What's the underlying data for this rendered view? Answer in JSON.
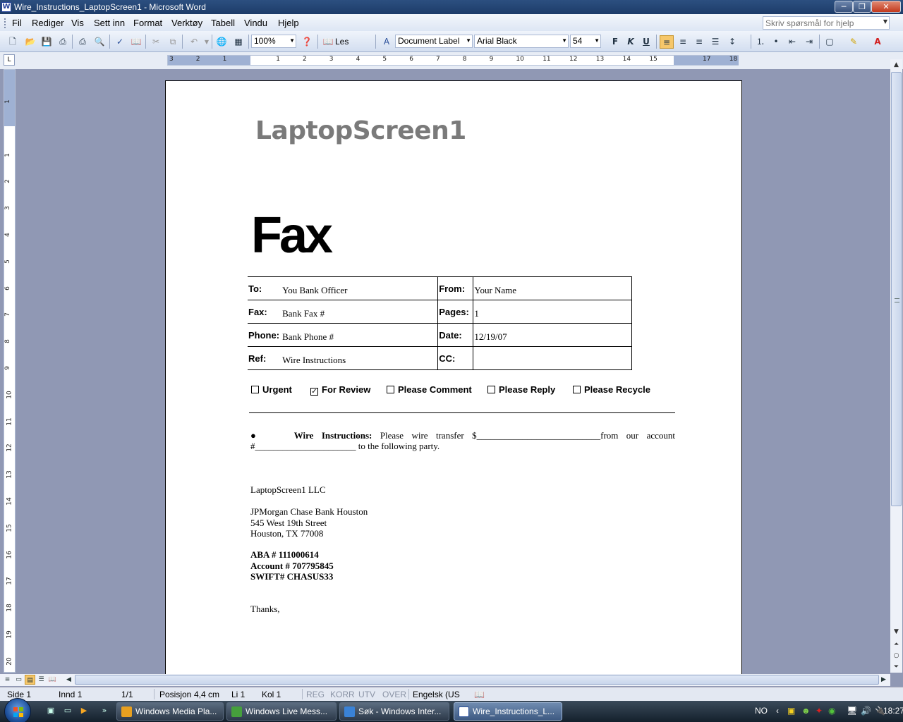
{
  "window": {
    "title": "Wire_Instructions_LaptopScreen1 - Microsoft Word",
    "app_icon": "W",
    "min_glyph": "─",
    "max_glyph": "❐",
    "close_glyph": "✕"
  },
  "menu": {
    "items": [
      "Fil",
      "Rediger",
      "Vis",
      "Sett inn",
      "Format",
      "Verktøy",
      "Tabell",
      "Vindu",
      "Hjelp"
    ],
    "help_placeholder": "Skriv spørsmål for hjelp"
  },
  "toolbar": {
    "zoom": "100%",
    "read_label": "Les",
    "style": "Document Label",
    "font": "Arial Black",
    "size": "54",
    "bold": "F",
    "italic": "K",
    "underline": "U"
  },
  "ruler": {
    "corner": "L",
    "h_numbers": [
      "3",
      "2",
      "1",
      "",
      "1",
      "2",
      "3",
      "4",
      "5",
      "6",
      "7",
      "8",
      "9",
      "10",
      "11",
      "12",
      "13",
      "14",
      "15",
      "",
      "17",
      "18"
    ],
    "v_numbers": [
      "1",
      "",
      "1",
      "2",
      "3",
      "4",
      "5",
      "6",
      "7",
      "8",
      "9",
      "10",
      "11",
      "12",
      "13",
      "14",
      "15",
      "16",
      "17",
      "18",
      "19",
      "20"
    ]
  },
  "document": {
    "logo": "LaptopScreen1",
    "title": "Fax",
    "fields": [
      {
        "label": "To:",
        "value": "You Bank Officer",
        "label2": "From:",
        "value2": "Your Name"
      },
      {
        "label": "Fax:",
        "value": "Bank Fax #",
        "label2": "Pages:",
        "value2": "1"
      },
      {
        "label": "Phone:",
        "value": "Bank Phone #",
        "label2": "Date:",
        "value2": "12/19/07"
      },
      {
        "label": "Ref:",
        "value": "Wire Instructions",
        "label2": "CC:",
        "value2": ""
      }
    ],
    "checkboxes": [
      {
        "label": "Urgent",
        "checked": false
      },
      {
        "label": "For Review",
        "checked": true
      },
      {
        "label": "Please Comment",
        "checked": false
      },
      {
        "label": "Please Reply",
        "checked": false
      },
      {
        "label": "Please Recycle",
        "checked": false
      }
    ],
    "bullet": "●",
    "wire_heading": "Wire Instructions:",
    "wire_line1_a": "Please wire transfer $",
    "wire_blank1": "___________________________",
    "wire_line1_b": "from our account",
    "wire_line2_a": "#",
    "wire_blank2": "______________________",
    "wire_line2_b": " to the following party.",
    "company": "LaptopScreen1 LLC",
    "bank_name": "JPMorgan Chase Bank Houston",
    "bank_street": "545 West 19th Street",
    "bank_city": "Houston, TX 77008",
    "aba": "ABA # 111000614",
    "account": "Account # 707795845",
    "swift": "SWIFT# CHASUS33",
    "closing": "Thanks,"
  },
  "status": {
    "page": "Side 1",
    "section": "Innd 1",
    "pages": "1/1",
    "position": "Posisjon",
    "position_value": "4,4 cm",
    "line": "Li 1",
    "col": "Kol 1",
    "rec": "REG",
    "trk": "KORR",
    "ext": "UTV",
    "ovr": "OVER",
    "lang": "Engelsk (US"
  },
  "taskbar": {
    "tasks": [
      {
        "label": "Windows Media Pla...",
        "active": false
      },
      {
        "label": "Windows Live Mess...",
        "active": false
      },
      {
        "label": "Søk - Windows Inter...",
        "active": false
      },
      {
        "label": "Wire_Instructions_L...",
        "active": true
      }
    ],
    "lang": "NO",
    "clock": "18:27"
  },
  "colors": {
    "title_bar": "#1d3c69",
    "doc_background": "#9098b4",
    "logo_gray": "#7a7a7a"
  }
}
